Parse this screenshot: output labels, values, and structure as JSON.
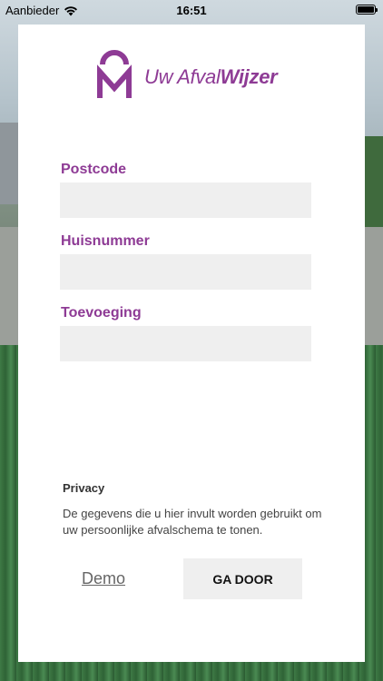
{
  "status_bar": {
    "carrier": "Aanbieder",
    "time": "16:51",
    "icons": [
      "wifi-icon",
      "battery-icon"
    ]
  },
  "logo": {
    "icon": "uw-afvalwijzer-logo",
    "text_part1": "Uw Afval",
    "text_part2": "Wijzer"
  },
  "form": {
    "postcode_label": "Postcode",
    "postcode_value": "",
    "huisnummer_label": "Huisnummer",
    "huisnummer_value": "",
    "toevoeging_label": "Toevoeging",
    "toevoeging_value": ""
  },
  "privacy": {
    "title": "Privacy",
    "text": "De gegevens die u hier invult worden gebruikt om uw persoonlijke afvalschema te tonen."
  },
  "actions": {
    "demo_label": "Demo",
    "go_label": "GA DOOR"
  },
  "colors": {
    "brand_purple": "#8e3b95",
    "input_bg": "#efefef"
  }
}
